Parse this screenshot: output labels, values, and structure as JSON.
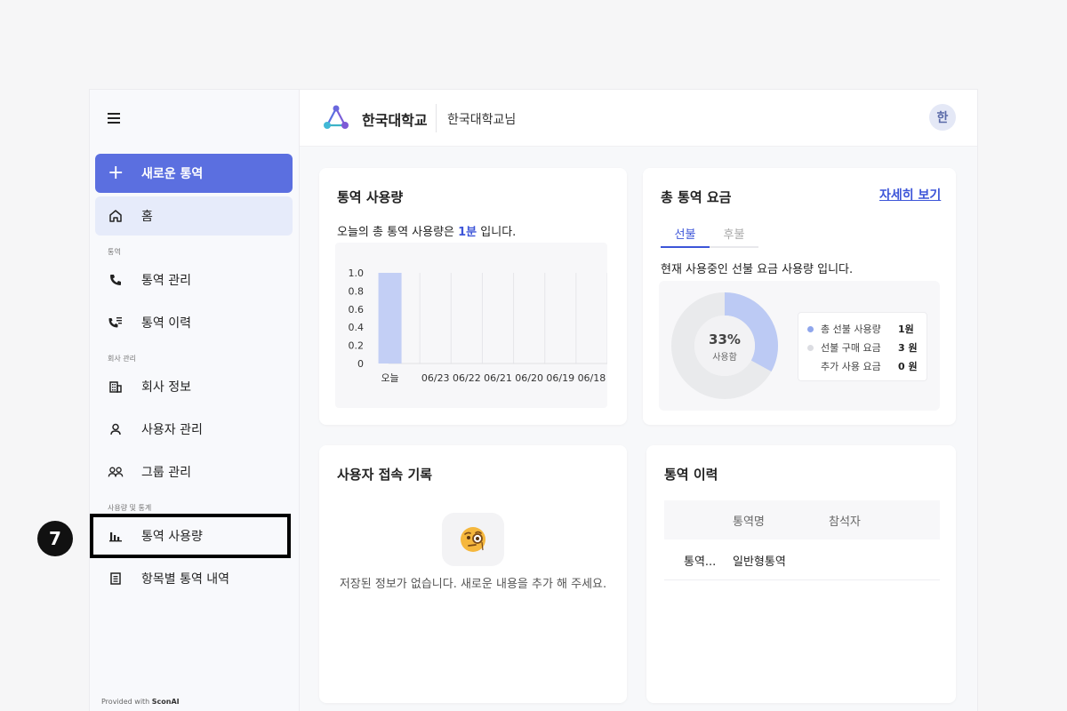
{
  "header": {
    "org_name": "한국대학교",
    "user_greeting": "한국대학교님",
    "avatar_initial": "한"
  },
  "sidebar": {
    "new_button": "새로운 통역",
    "home": "홈",
    "section_interpret": "통역",
    "interpret_manage": "통역 관리",
    "interpret_history": "통역 이력",
    "section_company": "회사 관리",
    "company_info": "회사 정보",
    "user_manage": "사용자 관리",
    "group_manage": "그룹 관리",
    "section_stats": "사용량 및 통계",
    "interpret_usage": "통역 사용량",
    "item_history": "항목별 통역 내역",
    "footer_prefix": "Provided with ",
    "footer_brand": "SconAI"
  },
  "step_badge": "7",
  "usage_card": {
    "title": "통역 사용량",
    "text_before": "오늘의 총 통역 사용량은 ",
    "text_value": "1분",
    "text_after": " 입니다."
  },
  "chart_data": {
    "type": "bar",
    "categories": [
      "오늘",
      "06/23",
      "06/22",
      "06/21",
      "06/20",
      "06/19",
      "06/18"
    ],
    "values": [
      1.0,
      0,
      0,
      0,
      0,
      0,
      0
    ],
    "ylim": [
      0,
      1.0
    ],
    "yticks": [
      "1.0",
      "0.8",
      "0.6",
      "0.4",
      "0.2",
      "0"
    ],
    "grid": true,
    "bar_color": "#c3cff5"
  },
  "fee_card": {
    "title": "총 통역 요금",
    "detail_link": "자세히 보기",
    "tab_prepaid": "선불",
    "tab_postpaid": "후불",
    "desc": "현재 사용중인 선불 요금 사용량 입니다.",
    "donut_percent": "33%",
    "donut_label": "사용함",
    "donut_fraction": 0.33,
    "legend": [
      {
        "label": "총 선불 사용량",
        "value": "1원",
        "color": "#8fa6ec"
      },
      {
        "label": "선불 구매 요금",
        "value": "3 원",
        "color": "#dcdde2"
      },
      {
        "label": "추가 사용 요금",
        "value": "0 원",
        "color": ""
      }
    ]
  },
  "access_card": {
    "title": "사용자 접속 기록",
    "empty_text": "저장된 정보가 없습니다. 새로운 내용을 추가 해 주세요."
  },
  "history_card": {
    "title": "통역 이력",
    "columns": [
      "통역명",
      "참석자"
    ],
    "rows": [
      {
        "col0": "통역...",
        "name": "일반형통역",
        "attendee": ""
      }
    ]
  },
  "colors": {
    "accent": "#5b6fe0",
    "link": "#3d55d8"
  }
}
